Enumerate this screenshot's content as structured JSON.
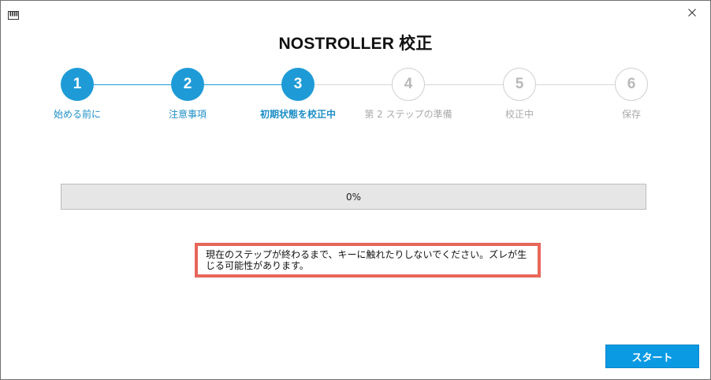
{
  "window": {
    "app_icon": "piano-keys-icon",
    "close_icon": "close-icon"
  },
  "dialog": {
    "title": "NOSTROLLER 校正"
  },
  "stepper": {
    "current_step": 3,
    "steps": [
      {
        "number": "1",
        "label": "始める前に",
        "state": "done"
      },
      {
        "number": "2",
        "label": "注意事項",
        "state": "done"
      },
      {
        "number": "3",
        "label": "初期状態を校正中",
        "state": "current"
      },
      {
        "number": "4",
        "label": "第 2 ステップの準備",
        "state": "todo"
      },
      {
        "number": "5",
        "label": "校正中",
        "state": "todo"
      },
      {
        "number": "6",
        "label": "保存",
        "state": "todo"
      }
    ]
  },
  "progress": {
    "value": 0,
    "text": "0%"
  },
  "notice": {
    "line1": "現在のステップが終わるまで、キーに触れたりしないでください。ズレが生",
    "line2": "じる可能性があります。"
  },
  "footer": {
    "start_label": "スタート"
  },
  "colors": {
    "accent": "#1e9bd7",
    "inactive": "#cfcfcf",
    "highlight_border": "#e8675a",
    "button": "#0a9ae4"
  }
}
